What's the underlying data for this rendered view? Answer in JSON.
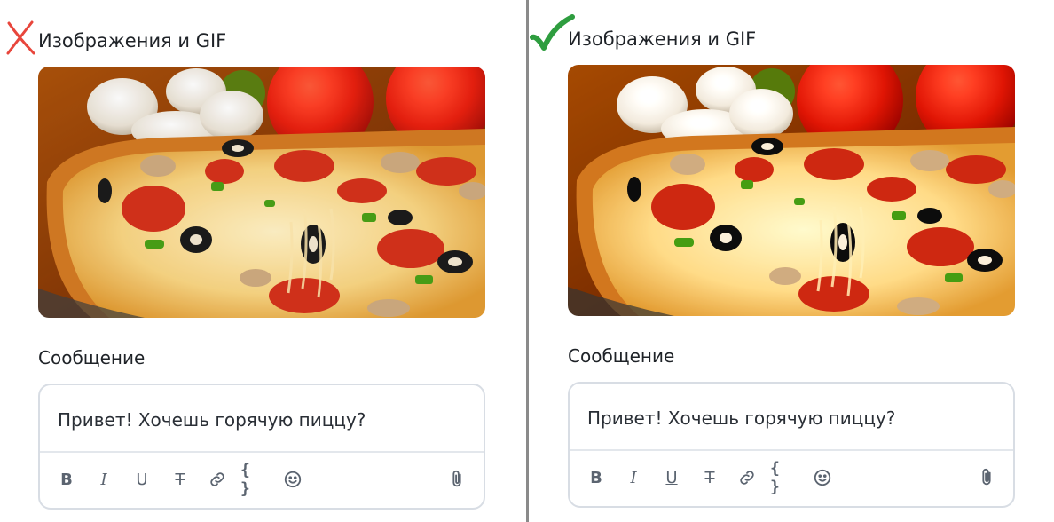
{
  "panels": [
    {
      "verdict": "incorrect",
      "verdict_icon": "red-cross-icon",
      "section_title": "Изображения и GIF",
      "message_label": "Сообщение",
      "message_text": "Привет! Хочешь горячую пиццу?",
      "toolbar": {
        "bold": "B",
        "italic": "I",
        "underline": "U",
        "strike": "T",
        "code": "{ }"
      }
    },
    {
      "verdict": "correct",
      "verdict_icon": "green-check-icon",
      "section_title": "Изображения и GIF",
      "message_label": "Сообщение",
      "message_text": "Привет! Хочешь горячую пиццу?",
      "toolbar": {
        "bold": "B",
        "italic": "I",
        "underline": "U",
        "strike": "T",
        "code": "{ }"
      }
    }
  ],
  "colors": {
    "cross": "#e8463c",
    "check": "#2e9d3f",
    "divider": "#8a8a8a",
    "border": "#d8dde4"
  }
}
